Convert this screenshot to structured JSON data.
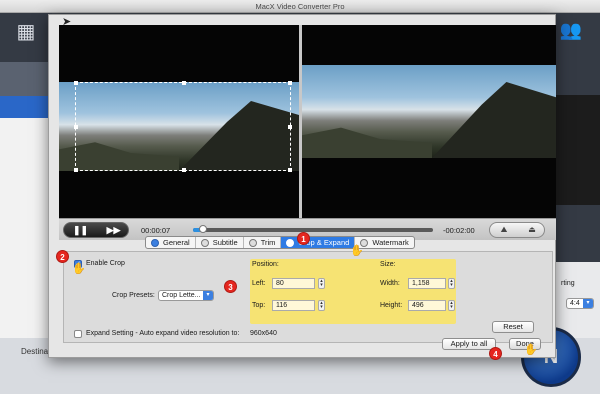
{
  "app": {
    "title": "MacX Video Converter Pro"
  },
  "background": {
    "destination_label": "Destina",
    "run_label": "N",
    "sort_label": "rting",
    "ratio_value": "4:4"
  },
  "player": {
    "elapsed": "00:00:07",
    "remaining": "-00:02:00",
    "progress": 0.04
  },
  "tabs": [
    {
      "label": "General",
      "active": false
    },
    {
      "label": "Subtitle",
      "active": false
    },
    {
      "label": "Trim",
      "active": false
    },
    {
      "label": "Crop & Expand",
      "active": true
    },
    {
      "label": "Watermark",
      "active": false
    }
  ],
  "crop": {
    "enable_label": "Enable Crop",
    "enabled": true,
    "presets_label": "Crop Presets:",
    "presets_value": "Crop Lette...",
    "position_label": "Position:",
    "size_label": "Size:",
    "left_label": "Left:",
    "left_value": "80",
    "top_label": "Top:",
    "top_value": "116",
    "width_label": "Width:",
    "width_value": "1,158",
    "height_label": "Height:",
    "height_value": "496",
    "reset_label": "Reset",
    "expand_label": "Expand Setting - Auto expand video resolution to:",
    "expand_value": "960x640"
  },
  "buttons": {
    "apply_all": "Apply to all",
    "done": "Done"
  },
  "markers": [
    "1",
    "2",
    "3",
    "4"
  ],
  "colors": {
    "accent": "#2f7be4",
    "highlight": "#ffe650",
    "marker": "#e5261f"
  }
}
